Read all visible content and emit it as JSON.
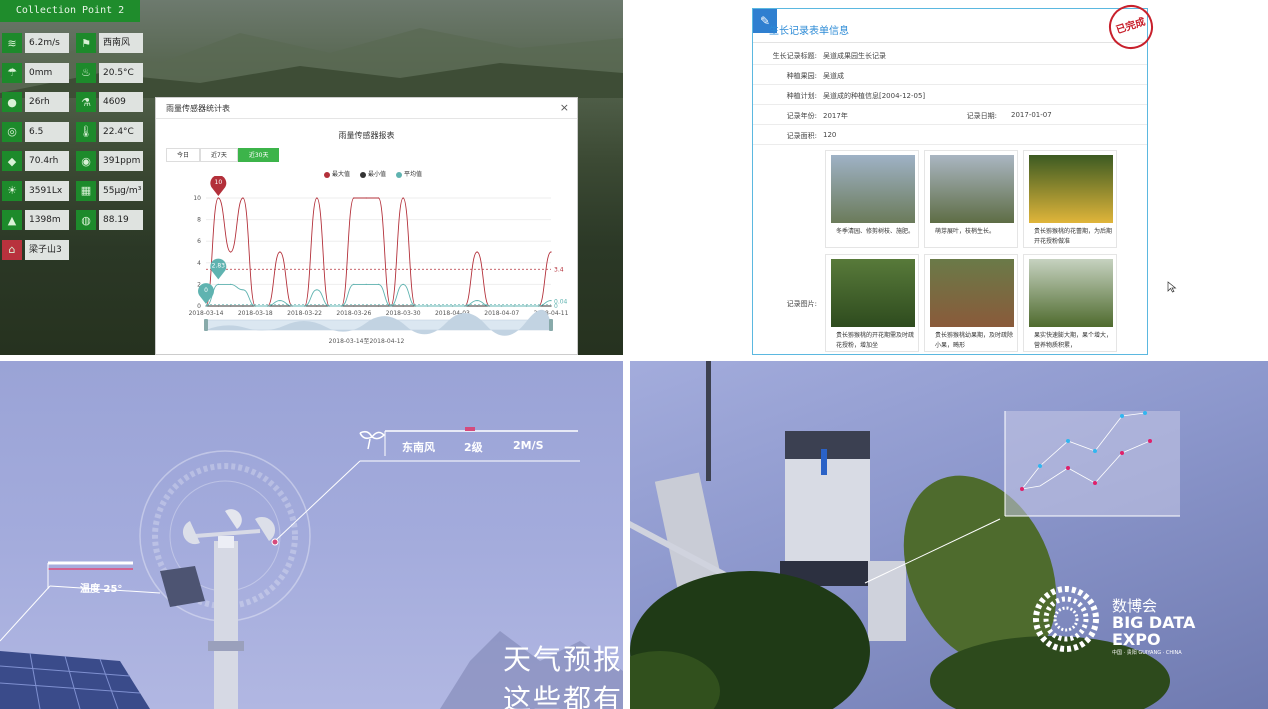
{
  "q1": {
    "collection_point": "Collection Point 2",
    "sensors": [
      {
        "icon": "wind-speed-icon",
        "value": "6.2m/s"
      },
      {
        "icon": "wind-direction-icon",
        "value": "西南风"
      },
      {
        "icon": "rain-icon",
        "value": "0mm"
      },
      {
        "icon": "temperature-icon",
        "value": "20.5°C"
      },
      {
        "icon": "humidity-icon",
        "value": "26rh"
      },
      {
        "icon": "flask-icon",
        "value": "4609"
      },
      {
        "icon": "soil-ph-icon",
        "value": "6.5"
      },
      {
        "icon": "thermometer-icon",
        "value": "22.4°C"
      },
      {
        "icon": "drop-icon",
        "value": "70.4rh"
      },
      {
        "icon": "co2-icon",
        "value": "391ppm"
      },
      {
        "icon": "sun-icon",
        "value": "3591Lx"
      },
      {
        "icon": "pm25-icon",
        "value": "55μg/m³"
      },
      {
        "icon": "altitude-icon",
        "value": "1398m"
      },
      {
        "icon": "pressure-icon",
        "value": "88.19"
      },
      {
        "icon": "location-icon",
        "value": "梁子山3"
      }
    ],
    "dialog": {
      "title": "雨量传感器统计表",
      "close": "×",
      "tabs": [
        "今日",
        "近7天",
        "近30天"
      ],
      "active_tab": 2,
      "date_range": "2018-03-14至2018-04-12"
    }
  },
  "chart_data": {
    "type": "line",
    "title": "雨量传感器报表",
    "ylim": [
      0,
      10
    ],
    "yticks": [
      "0",
      "2",
      "4",
      "6",
      "8",
      "10"
    ],
    "xticks": [
      "2018-03-14",
      "2018-03-18",
      "2018-03-22",
      "2018-03-26",
      "2018-03-30",
      "2018-04-03",
      "2018-04-07",
      "2018-04-11"
    ],
    "x": [
      "03-14",
      "03-15",
      "03-16",
      "03-17",
      "03-18",
      "03-19",
      "03-20",
      "03-21",
      "03-22",
      "03-23",
      "03-24",
      "03-25",
      "03-26",
      "03-27",
      "03-28",
      "03-29",
      "03-30",
      "03-31",
      "04-01",
      "04-02",
      "04-03",
      "04-04",
      "04-05",
      "04-06",
      "04-07",
      "04-08",
      "04-09",
      "04-10",
      "04-11"
    ],
    "series": [
      {
        "name": "最大值",
        "color": "#b3303a",
        "values": [
          0,
          10,
          5,
          10,
          0,
          0,
          5,
          0,
          0,
          10,
          0,
          0,
          10,
          10,
          10,
          0,
          10,
          0,
          0,
          0,
          0,
          0,
          5,
          0,
          0,
          0,
          0,
          0,
          5
        ]
      },
      {
        "name": "最小值",
        "color": "#333333",
        "values": [
          0,
          0,
          0,
          0,
          0,
          0,
          0,
          0,
          0,
          0,
          0,
          0,
          0,
          0,
          0,
          0,
          0,
          0,
          0,
          0,
          0,
          0,
          0,
          0,
          0,
          0,
          0,
          0,
          0
        ]
      },
      {
        "name": "平均值",
        "color": "#5fb3b0",
        "values": [
          0,
          2,
          2,
          1.5,
          0,
          0,
          0.5,
          0,
          0,
          1.5,
          0,
          0,
          2,
          2,
          2,
          0,
          2,
          0,
          0,
          0,
          0,
          0,
          0.5,
          0,
          0,
          0,
          0,
          0,
          0.5
        ]
      }
    ],
    "max_marker": "10",
    "min_marker": "0",
    "avg_marker": "2.83",
    "avg_line_label": "3.4",
    "min_line_label": "0.04",
    "zero_label": "0"
  },
  "q2": {
    "title": "生长记录表单信息",
    "stamp": "已完成",
    "rows": [
      {
        "label": "生长记录标题:",
        "value": "吴道成果园生长记录"
      },
      {
        "label": "种植果园:",
        "value": "吴道成"
      },
      {
        "label": "种植计划:",
        "value": "吴道成的种植信息[2004-12-05]"
      },
      {
        "label": "记录年份:",
        "value": "2017年",
        "label2": "记录日期:",
        "value2": "2017-01-07"
      },
      {
        "label": "记录面积:",
        "value": "120"
      }
    ],
    "photo_label": "记录图片:",
    "photos": [
      {
        "caption": "冬季清园、修剪树枝、施肥。",
        "colors": [
          "#9fb2c6",
          "#6b7b5a"
        ]
      },
      {
        "caption": "萌芽展叶，枝梢生长。",
        "colors": [
          "#aab6c2",
          "#5e6d45"
        ]
      },
      {
        "caption": "贵长猕猴桃的花蕾期，为后期开花授粉做准",
        "colors": [
          "#3c5a22",
          "#e0b53a"
        ]
      },
      {
        "caption": "贵长猕猴桃的开花期需及时疏花授粉，增加坐",
        "colors": [
          "#587a3a",
          "#2e4b1e"
        ]
      },
      {
        "caption": "贵长猕猴桃幼果期，及时疏除小果，畸形",
        "colors": [
          "#6a7a48",
          "#8a5a3a"
        ]
      },
      {
        "caption": "果实快速膨大期，果个增大，营养物质积累，",
        "colors": [
          "#c6d2c0",
          "#4f6b2e"
        ]
      }
    ]
  },
  "q3": {
    "wind_dir": "东南风",
    "wind_level": "2级",
    "wind_speed": "2M/S",
    "temperature": "温度 25°",
    "subtitle": "天气预报这些都有"
  },
  "q4": {
    "logo_cn": "数博会",
    "logo_en1": "BIG DATA",
    "logo_en2": "EXPO",
    "logo_sub": "中国 · 贵阳  GUIYANG · CHINA"
  }
}
